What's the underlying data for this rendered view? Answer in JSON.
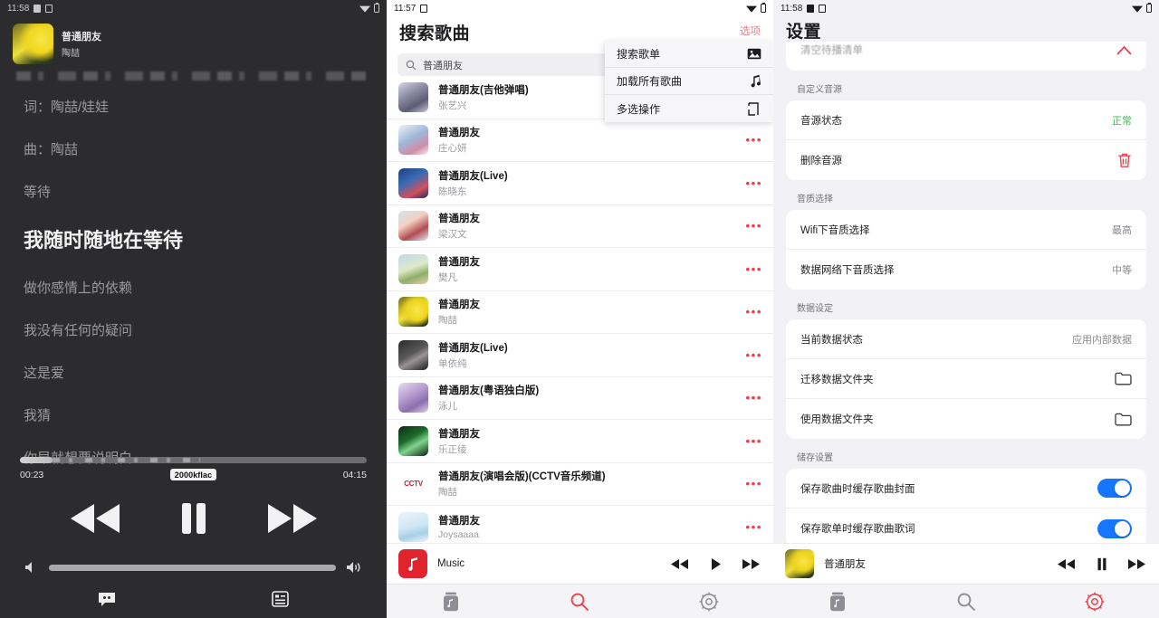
{
  "player": {
    "status_bar": {
      "time": "11:58",
      "wifi_icon": "wifi-icon",
      "battery_icon": "battery-icon"
    },
    "now_playing": {
      "title": "普通朋友",
      "artist": "陶喆"
    },
    "lyrics_meta": [
      {
        "text": "词：陶喆/娃娃"
      },
      {
        "text": "曲：陶喆"
      }
    ],
    "lyrics": [
      {
        "text": "等待",
        "active": false
      },
      {
        "text": "我随时随地在等待",
        "active": true,
        "highlight": "我随"
      },
      {
        "text": "做你感情上的依赖",
        "active": false
      },
      {
        "text": "我没有任何的疑问",
        "active": false
      },
      {
        "text": "这是爱",
        "active": false
      },
      {
        "text": "我猜",
        "active": false
      },
      {
        "text": "你早就想要说明白",
        "active": false
      }
    ],
    "progress": {
      "elapsed": "00:23",
      "total": "04:15",
      "quality_badge": "2000kflac",
      "percent": 9.3
    },
    "controls": {
      "previous": "rewind-icon",
      "play_pause": "pause-icon",
      "next": "fast-forward-icon",
      "volume_low": "volume-low-icon",
      "volume_high": "volume-high-icon",
      "lyrics_toggle": "lyrics-icon",
      "playlist_toggle": "playlist-icon"
    }
  },
  "search": {
    "status_bar": {
      "time": "11:57"
    },
    "title": "搜索歌曲",
    "options_label": "选项",
    "search_input": {
      "value": "普通朋友",
      "placeholder": "搜索歌曲"
    },
    "menu": [
      {
        "label": "搜索歌单",
        "icon": "image-icon"
      },
      {
        "label": "加载所有歌曲",
        "icon": "music-note-icon"
      },
      {
        "label": "多选操作",
        "icon": "multi-select-icon"
      }
    ],
    "songs": [
      {
        "name": "普通朋友(吉他弹唱)",
        "artist": "张艺兴",
        "art": "art-guitar"
      },
      {
        "name": "普通朋友",
        "artist": "庄心妍",
        "art": "art-blue-pink"
      },
      {
        "name": "普通朋友(Live)",
        "artist": "陈晓东",
        "art": "art-navy"
      },
      {
        "name": "普通朋友",
        "artist": "梁汉文",
        "art": "art-portrait"
      },
      {
        "name": "普通朋友",
        "artist": "樊凡",
        "art": "art-scene"
      },
      {
        "name": "普通朋友",
        "artist": "陶喆",
        "art": "art-yellow"
      },
      {
        "name": "普通朋友(Live)",
        "artist": "单依纯",
        "art": "art-dark"
      },
      {
        "name": "普通朋友(粤语独白版)",
        "artist": "泳儿",
        "art": "art-violet"
      },
      {
        "name": "普通朋友",
        "artist": "乐正绫",
        "art": "art-green"
      },
      {
        "name": "普通朋友(演唱会版)(CCTV音乐频道)",
        "artist": "陶喆",
        "art": "art-cctv"
      },
      {
        "name": "普通朋友",
        "artist": "Joysaaaa",
        "art": "art-lightblue"
      }
    ],
    "more_icon": "more-options-icon",
    "mini_player": {
      "app_name": "Music",
      "app_icon": "music-app-icon",
      "previous": "rewind-icon",
      "play": "play-icon",
      "next": "fast-forward-icon"
    },
    "tabs": [
      {
        "name": "library",
        "icon": "library-icon",
        "active": false
      },
      {
        "name": "search",
        "icon": "search-icon",
        "active": true
      },
      {
        "name": "settings",
        "icon": "settings-icon",
        "active": false
      }
    ]
  },
  "settings": {
    "status_bar": {
      "time": "11:58"
    },
    "title": "设置",
    "clipped_row": {
      "label": "清空待播清单",
      "icon": "chevron-up-icon"
    },
    "groups": [
      {
        "label": "自定义音源",
        "rows": [
          {
            "label": "音源状态",
            "value": "正常",
            "value_color": "green",
            "control": "text"
          },
          {
            "label": "删除音源",
            "value": "",
            "control": "trash-icon"
          }
        ]
      },
      {
        "label": "音质选择",
        "rows": [
          {
            "label": "Wifi下音质选择",
            "value": "最高",
            "control": "text"
          },
          {
            "label": "数据网络下音质选择",
            "value": "中等",
            "control": "text"
          }
        ]
      },
      {
        "label": "数据设定",
        "rows": [
          {
            "label": "当前数据状态",
            "value": "应用内部数据",
            "control": "text"
          },
          {
            "label": "迁移数据文件夹",
            "value": "",
            "control": "folder-icon"
          },
          {
            "label": "使用数据文件夹",
            "value": "",
            "control": "folder-icon"
          }
        ]
      },
      {
        "label": "储存设置",
        "rows": [
          {
            "label": "保存歌曲时缓存歌曲封面",
            "value": "",
            "control": "toggle-on"
          },
          {
            "label": "保存歌单时缓存歌曲歌词",
            "value": "",
            "control": "toggle-on"
          }
        ]
      }
    ],
    "mini_player": {
      "title": "普通朋友",
      "previous": "rewind-icon",
      "play_pause": "pause-icon",
      "next": "fast-forward-icon"
    },
    "tabs": [
      {
        "name": "library",
        "icon": "library-icon",
        "active": false
      },
      {
        "name": "search",
        "icon": "search-icon",
        "active": false
      },
      {
        "name": "settings",
        "icon": "settings-icon",
        "active": true
      }
    ]
  },
  "colors": {
    "accent_red": "#e8434f",
    "toggle_blue": "#1577ff",
    "status_green": "#37c04a",
    "dark_bg": "#2c2c2e",
    "settings_bg": "#f1f1f6"
  }
}
